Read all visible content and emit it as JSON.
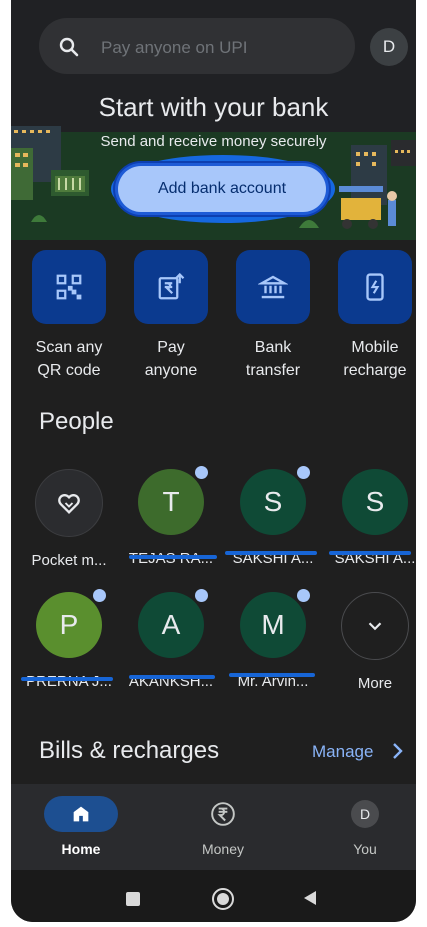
{
  "search": {
    "placeholder": "Pay anyone on UPI",
    "avatar_letter": "D"
  },
  "hero": {
    "title": "Start with your bank",
    "subtitle": "Send and receive money securely",
    "button": "Add bank account"
  },
  "actions": [
    {
      "label_line1": "Scan any",
      "label_line2": "QR code",
      "icon": "qr-code-icon"
    },
    {
      "label_line1": "Pay",
      "label_line2": "anyone",
      "icon": "pay-anyone-icon"
    },
    {
      "label_line1": "Bank",
      "label_line2": "transfer",
      "icon": "bank-icon"
    },
    {
      "label_line1": "Mobile",
      "label_line2": "recharge",
      "icon": "mobile-recharge-icon"
    }
  ],
  "people": {
    "title": "People",
    "row1": [
      {
        "initial": "",
        "name": "Pocket m...",
        "color": "#2b2c2f",
        "icon": "pocket-money-icon",
        "new": false
      },
      {
        "initial": "T",
        "name": "TEJAS RA...",
        "color": "#3d6b2c",
        "new": true
      },
      {
        "initial": "S",
        "name": "SAKSHI A...",
        "color": "#0f4a36",
        "new": true
      },
      {
        "initial": "S",
        "name": "SAKSHI A...",
        "color": "#0f4a36",
        "new": false
      }
    ],
    "row2": [
      {
        "initial": "P",
        "name": "PRERNA J...",
        "color": "#5a8f2e",
        "new": true
      },
      {
        "initial": "A",
        "name": "AKANKSH...",
        "color": "#0f4a36",
        "new": true
      },
      {
        "initial": "M",
        "name": "Mr. Arvin...",
        "color": "#0f4a36",
        "new": true
      },
      {
        "initial": "",
        "name": "More",
        "color": "#1f1f1f",
        "icon": "chevron-down-icon",
        "new": false
      }
    ]
  },
  "bills": {
    "title": "Bills & recharges",
    "manage": "Manage"
  },
  "bottom_nav": [
    {
      "label": "Home",
      "active": true,
      "icon": "home-icon"
    },
    {
      "label": "Money",
      "active": false,
      "icon": "rupee-icon"
    },
    {
      "label": "You",
      "active": false,
      "icon": "profile-icon",
      "letter": "D"
    }
  ],
  "colors": {
    "accent": "#a8c7fa",
    "tile": "#0b3a8f",
    "link": "#8ab4f8",
    "background": "#1f1f1f"
  }
}
